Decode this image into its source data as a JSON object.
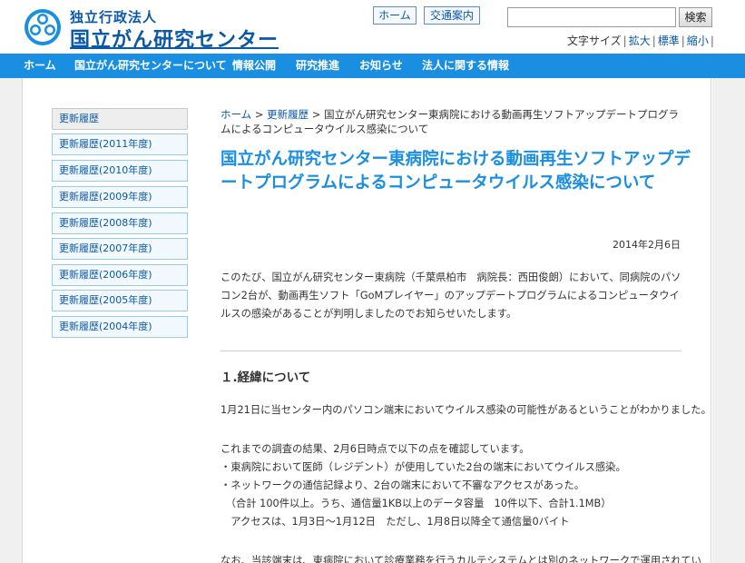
{
  "header": {
    "logo_sub": "独立行政法人",
    "logo_main": "国立がん研究センター",
    "home_button": "ホーム",
    "access_button": "交通案内",
    "search_placeholder": "",
    "search_button": "検索",
    "font_size_label": "文字サイズ",
    "font_large": "拡大",
    "font_standard": "標準",
    "font_small": "縮小",
    "brand_color": "#0a58a8"
  },
  "nav": {
    "items": [
      "ホーム",
      "国立がん研究センターについて",
      "情報公開",
      "研究推進",
      "お知らせ",
      "法人に関する情報"
    ],
    "bg_color": "#1a8ee1"
  },
  "sidebar": {
    "items": [
      "更新履歴",
      "更新履歴(2011年度)",
      "更新履歴(2010年度)",
      "更新履歴(2009年度)",
      "更新履歴(2008年度)",
      "更新履歴(2007年度)",
      "更新履歴(2006年度)",
      "更新履歴(2005年度)",
      "更新履歴(2004年度)"
    ]
  },
  "breadcrumb": {
    "home": "ホーム",
    "sep": " > ",
    "history": "更新履歴",
    "current": "国立がん研究センター東病院における動画再生ソフトアップデートプログラムによるコンピュータウイルス感染について"
  },
  "article": {
    "title": "国立がん研究センター東病院における動画再生ソフトアップデートプログラムによるコンピュータウイルス感染について",
    "date": "2014年2月6日",
    "intro": "このたび、国立がん研究センター東病院（千葉県柏市　病院長：西田俊朗）において、同病院のパソコン2台が、動画再生ソフト「GoMプレイヤー」のアップデートプログラムによるコンピュータウイルスの感染があることが判明しましたのでお知らせいたします。",
    "section1_heading": "１.経緯について",
    "p1": "1月21日に当センター内のパソコン端末においてウイルス感染の可能性があるということがわかりました。",
    "p2": "これまでの調査の結果、2月6日時点で以下の点を確認しています。",
    "p3": "・東病院において医師（レジデント）が使用していた2台の端末においてウイルス感染。",
    "p4": "・ネットワークの通信記録より、2台の端末において不審なアクセスがあった。",
    "p5": "　（合計 100件以上。うち、通信量1KB以上のデータ容量　10件以下、合計1.1MB）",
    "p6": "　アクセスは、1月3日～1月12日　ただし、1月8日以降全て通信量0バイト",
    "p7": "なお、当該端末は、東病院において診療業務を行うカルテシステムとは別のネットワークで運用されてい"
  }
}
